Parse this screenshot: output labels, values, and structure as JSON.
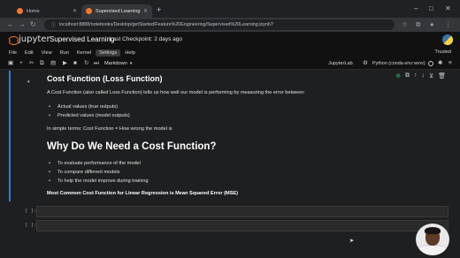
{
  "browser": {
    "tabs": [
      {
        "label": "Home",
        "active": false,
        "favicon_color": "#f37726"
      },
      {
        "label": "Supervised Learning",
        "active": true,
        "favicon_color": "#f37726"
      }
    ],
    "url": "localhost:8888/notebooks/Desktop/getStarted/Feature%20Engineering/Supervised%20Learning.ipynb?"
  },
  "jupyter": {
    "logo_text": "jupyter",
    "notebook_title": "Supervised Learning",
    "checkpoint": "Last Checkpoint: 2 days ago",
    "menu": [
      "File",
      "Edit",
      "View",
      "Run",
      "Kernel",
      "Settings",
      "Help"
    ],
    "active_menu": "Settings",
    "trusted": "Trusted",
    "cell_type": "Markdown",
    "jupyterlab_label": "JupyterLab",
    "kernel": "Python (conda env:venv)"
  },
  "markdown_cell": {
    "heading1": "Cost Function (Loss Function)",
    "intro": "A Cost Function (also called Loss Function) tells us how well our model is performing by measuring the error between:",
    "bullets1": [
      "Actual values (true outputs)",
      "Predicted values (model outputs)"
    ],
    "simple_terms": "In simple terms: Cost Function = How wrong the model is",
    "heading2": "Why Do We Need a Cost Function?",
    "bullets2": [
      "To evaluate performance of the model",
      "To compare different models",
      "To help the model improve during training"
    ],
    "bold_line": "Most Common Cost Function for Linear Regression is Mean Squared Error (MSE)"
  },
  "code_cells": [
    {
      "prompt": "[ ]:"
    },
    {
      "prompt": "[ ]:"
    }
  ],
  "colors": {
    "accent": "#2f7fd6",
    "jupyter_orange": "#f37726",
    "background": "#1e1f20"
  }
}
